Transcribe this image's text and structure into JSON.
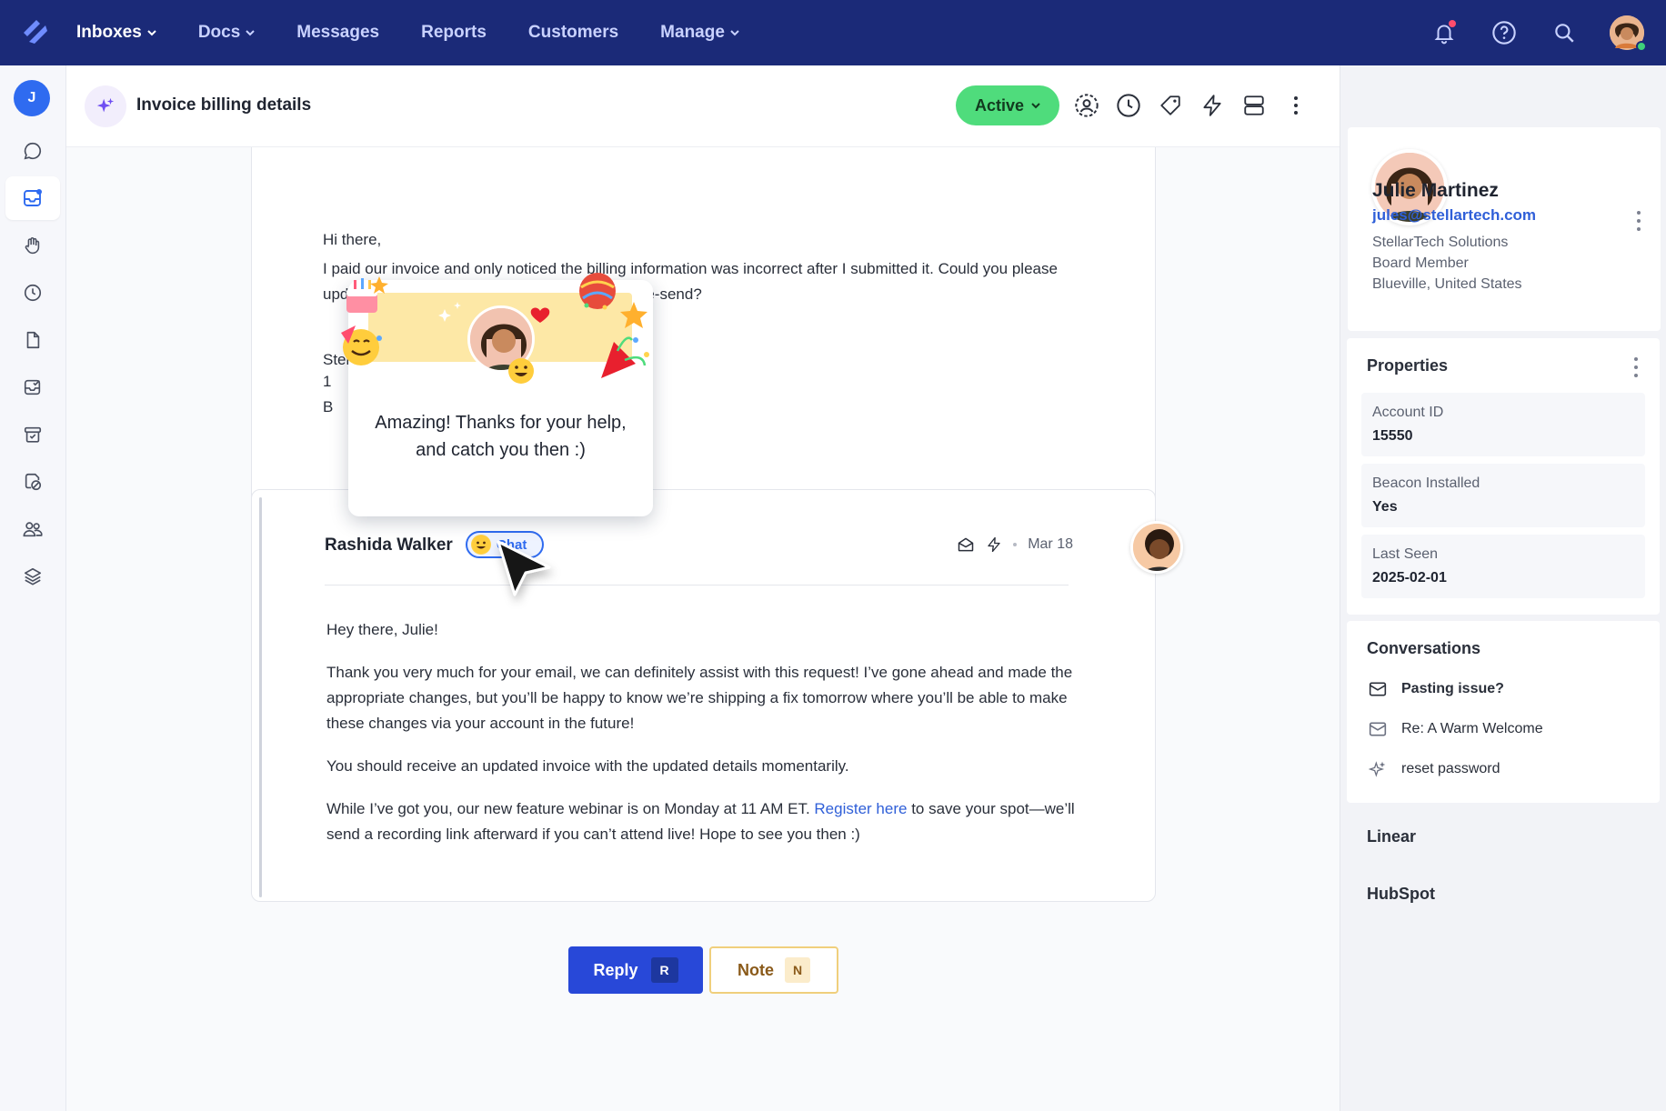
{
  "nav": {
    "items": [
      {
        "label": "Inboxes",
        "has_dropdown": true,
        "current": true
      },
      {
        "label": "Docs",
        "has_dropdown": true,
        "current": false
      },
      {
        "label": "Messages",
        "has_dropdown": false,
        "current": false
      },
      {
        "label": "Reports",
        "has_dropdown": false,
        "current": false
      },
      {
        "label": "Customers",
        "has_dropdown": false,
        "current": false
      },
      {
        "label": "Manage",
        "has_dropdown": true,
        "current": false
      }
    ],
    "right_icons": [
      "bell-icon",
      "help-icon",
      "search-icon",
      "user-avatar"
    ],
    "bg_color": "#1b2a78"
  },
  "sidebar": {
    "user_initial": "J",
    "items": [
      "chat-icon",
      "inbox-icon",
      "hand-icon",
      "clock-icon",
      "document-icon",
      "checked-inbox-icon",
      "archive-icon",
      "spam-icon",
      "people-icon",
      "layers-icon"
    ],
    "active_index": 1
  },
  "header": {
    "title": "Invoice billing details",
    "status_label": "Active",
    "status_color": "#4fdc7c",
    "tools": [
      "assign-user-icon",
      "clock-icon",
      "tag-icon",
      "bolt-icon",
      "layout-icon",
      "more-icon"
    ]
  },
  "thread": {
    "first_message": {
      "greeting": "Hi there,",
      "body": "I paid our invoice and only noticed the billing information was  incorrect after I submitted it. Could you please update our account with the details below and re-send?",
      "signature_line1": "StellarTech Solutions",
      "signature_line2": "1",
      "signature_line3": "B"
    },
    "reply": {
      "author": "Rashida Walker",
      "badge": "Chat",
      "date": "Mar 18",
      "greeting": "Hey there, Julie!",
      "p1": "Thank you very much for your email, we can definitely assist with this request! I’ve gone ahead and made the appropriate changes, but you’ll be happy to know we’re shipping a fix tomorrow where you’ll be able to make these changes via your account in the future!",
      "p2": "You should receive an updated invoice with the updated details momentarily.",
      "p3_before": "While I’ve got you, our new feature webinar is on Monday at 11 AM ET. ",
      "p3_link": "Register here",
      "p3_after": " to save your spot—we’ll send a recording link afterward if you can’t attend live! Hope to see you then :)"
    }
  },
  "celebration": {
    "text_line1": "Amazing! Thanks for your help,",
    "text_line2": "and catch you then :)"
  },
  "actions": {
    "reply_label": "Reply",
    "reply_key": "R",
    "note_label": "Note",
    "note_key": "N"
  },
  "customer": {
    "name": "Julie Martinez",
    "email": "jules@stellartech.com",
    "company": "StellarTech Solutions",
    "role": "Board Member",
    "location": "Blueville, United States"
  },
  "properties": {
    "title": "Properties",
    "items": [
      {
        "label": "Account ID",
        "value": "15550"
      },
      {
        "label": "Beacon Installed",
        "value": "Yes"
      },
      {
        "label": "Last Seen",
        "value": "2025-02-01"
      }
    ]
  },
  "conversations": {
    "title": "Conversations",
    "items": [
      {
        "label": "Pasting issue?",
        "icon": "mail-icon",
        "bold": true
      },
      {
        "label": "Re: A Warm Welcome",
        "icon": "mail-icon",
        "bold": false
      },
      {
        "label": "reset password",
        "icon": "sparkle-icon",
        "bold": false
      }
    ]
  },
  "integrations": [
    "Linear",
    "HubSpot"
  ]
}
